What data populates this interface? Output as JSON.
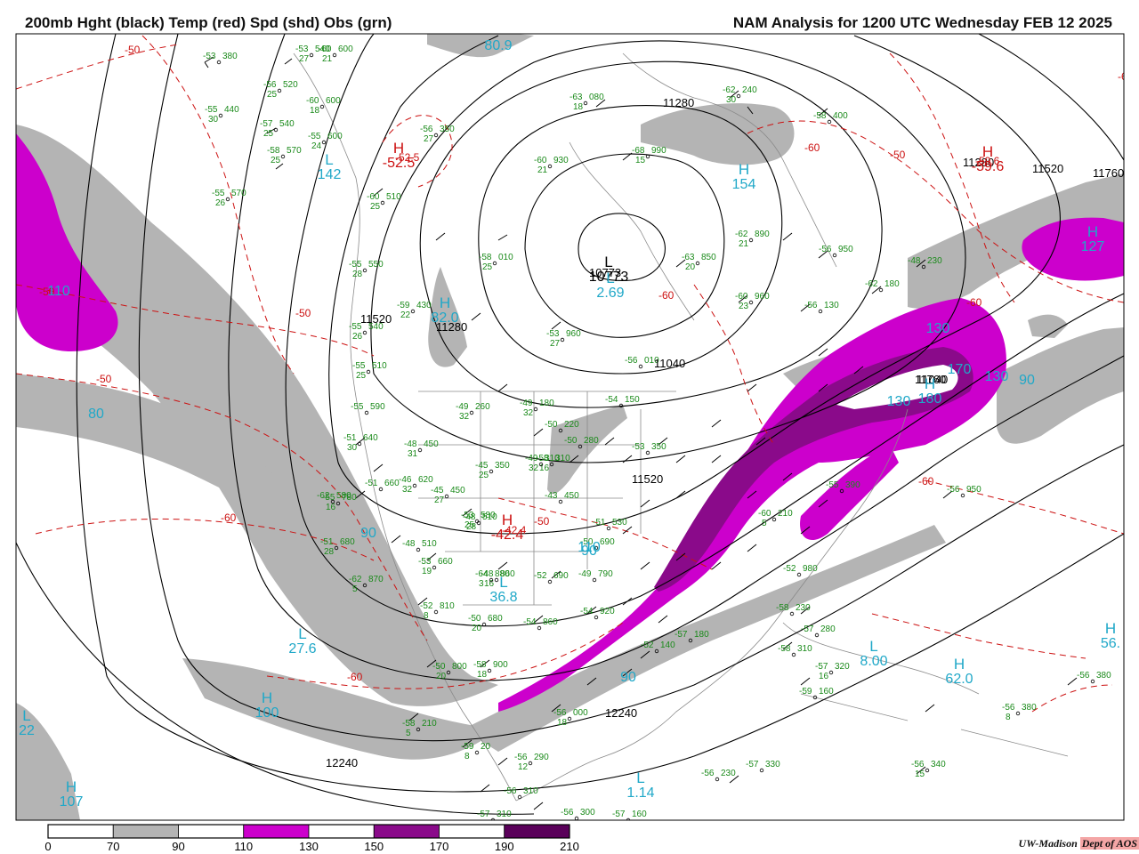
{
  "header": {
    "left_title": "200mb Hght (black) Temp (red) Spd (shd) Obs (grn)",
    "right_title": "NAM Analysis for 1200 UTC Wednesday  FEB 12 2025"
  },
  "colors": {
    "height_contour": "#000000",
    "temperature_contour": "#cc1111",
    "observations": "#1a8a1a",
    "speed_labels": "#20a8c8",
    "speed_70_90": "#b4b4b4",
    "speed_110_130": "#cc00cc",
    "speed_150_170": "#8a0a8a",
    "speed_190_210": "#5a005a"
  },
  "legend": {
    "ticks": [
      "0",
      "70",
      "90",
      "110",
      "130",
      "150",
      "170",
      "190",
      "210"
    ],
    "bins": [
      {
        "range": "0-70",
        "color": "#ffffff"
      },
      {
        "range": "70-90",
        "color": "#b4b4b4"
      },
      {
        "range": "90-110",
        "color": "#ffffff"
      },
      {
        "range": "110-130",
        "color": "#cc00cc"
      },
      {
        "range": "130-150",
        "color": "#ffffff"
      },
      {
        "range": "150-170",
        "color": "#8a0a8a"
      },
      {
        "range": "170-190",
        "color": "#ffffff"
      },
      {
        "range": "190-210",
        "color": "#5a005a"
      }
    ]
  },
  "height_labels": [
    "11520",
    "11280",
    "11040",
    "10773",
    "11280",
    "11520",
    "11760",
    "11040",
    "11520",
    "11760",
    "12240",
    "12240",
    "11280"
  ],
  "temperature_labels": [
    "-50",
    "-50",
    "-50",
    "-50",
    "-50",
    "-50",
    "-60",
    "-60",
    "-60",
    "-60",
    "-60",
    "-60",
    "-60",
    "-52.5",
    "-59.6",
    "-42.4"
  ],
  "pressure_centers": [
    {
      "type": "H",
      "value": "-52.5",
      "kind": "temp"
    },
    {
      "type": "H",
      "value": "-59.6",
      "kind": "temp"
    },
    {
      "type": "H",
      "value": "-42.4",
      "kind": "temp"
    },
    {
      "type": "L",
      "value": "10773",
      "kind": "height"
    },
    {
      "type": "L",
      "value": "142",
      "kind": "speed"
    },
    {
      "type": "H",
      "value": "154",
      "kind": "speed"
    },
    {
      "type": "H",
      "value": "127",
      "kind": "speed"
    },
    {
      "type": "H",
      "value": "82.0",
      "kind": "speed"
    },
    {
      "type": "L",
      "value": "2.69",
      "kind": "speed"
    },
    {
      "type": "L",
      "value": "27.6",
      "kind": "speed"
    },
    {
      "type": "H",
      "value": "100",
      "kind": "speed"
    },
    {
      "type": "L",
      "value": "22",
      "kind": "speed"
    },
    {
      "type": "H",
      "value": "107",
      "kind": "speed"
    },
    {
      "type": "L",
      "value": "36.8",
      "kind": "speed"
    },
    {
      "type": "L",
      "value": "8.00",
      "kind": "speed"
    },
    {
      "type": "H",
      "value": "62.0",
      "kind": "speed"
    },
    {
      "type": "H",
      "value": "56.",
      "kind": "speed"
    },
    {
      "type": "L",
      "value": "1.14",
      "kind": "speed"
    },
    {
      "type": "H",
      "value": "180",
      "kind": "speed"
    }
  ],
  "speed_labels": [
    "80.9",
    "130",
    "170",
    "130",
    "90",
    "80",
    "90",
    "90",
    "110",
    "130",
    "90",
    "110"
  ],
  "observations": [
    {
      "temp": "-53",
      "hgt": "380",
      "dew": ""
    },
    {
      "temp": "-53",
      "hgt": "540",
      "dew": "27"
    },
    {
      "temp": "-60",
      "hgt": "600",
      "dew": "21"
    },
    {
      "temp": "-56",
      "hgt": "520",
      "dew": "25"
    },
    {
      "temp": "-60",
      "hgt": "600",
      "dew": "18"
    },
    {
      "temp": "-55",
      "hgt": "440",
      "dew": "30"
    },
    {
      "temp": "-57",
      "hgt": "540",
      "dew": "25"
    },
    {
      "temp": "-55",
      "hgt": "600",
      "dew": "24"
    },
    {
      "temp": "-58",
      "hgt": "570",
      "dew": "25"
    },
    {
      "temp": "-55",
      "hgt": "570",
      "dew": "26"
    },
    {
      "temp": "-60",
      "hgt": "510",
      "dew": "25"
    },
    {
      "temp": "-55",
      "hgt": "550",
      "dew": "28"
    },
    {
      "temp": "-59",
      "hgt": "430",
      "dew": "22"
    },
    {
      "temp": "-55",
      "hgt": "540",
      "dew": "26"
    },
    {
      "temp": "-55",
      "hgt": "510",
      "dew": "25"
    },
    {
      "temp": "-55",
      "hgt": "590",
      "dew": ""
    },
    {
      "temp": "-51",
      "hgt": "640",
      "dew": "30"
    },
    {
      "temp": "-48",
      "hgt": "450",
      "dew": "31"
    },
    {
      "temp": "-51",
      "hgt": "660",
      "dew": ""
    },
    {
      "temp": "-46",
      "hgt": "620",
      "dew": "32"
    },
    {
      "temp": "-45",
      "hgt": "450",
      "dew": "27"
    },
    {
      "temp": "-55",
      "hgt": "780",
      "dew": "16"
    },
    {
      "temp": "-58",
      "hgt": "010",
      "dew": "25"
    },
    {
      "temp": "-58",
      "hgt": "310",
      "dew": "16"
    },
    {
      "temp": "-56",
      "hgt": "350",
      "dew": "27"
    },
    {
      "temp": "-60",
      "hgt": "930",
      "dew": "21"
    },
    {
      "temp": "-63",
      "hgt": "080",
      "dew": "18"
    },
    {
      "temp": "-62",
      "hgt": "240",
      "dew": "30"
    },
    {
      "temp": "-68",
      "hgt": "990",
      "dew": "15"
    },
    {
      "temp": "-58",
      "hgt": "400",
      "dew": ""
    },
    {
      "temp": "-62",
      "hgt": "890",
      "dew": "21"
    },
    {
      "temp": "-56",
      "hgt": "950",
      "dew": ""
    },
    {
      "temp": "-63",
      "hgt": "850",
      "dew": "20"
    },
    {
      "temp": "-48",
      "hgt": "230",
      "dew": ""
    },
    {
      "temp": "-62",
      "hgt": "180",
      "dew": ""
    },
    {
      "temp": "-60",
      "hgt": "960",
      "dew": "23"
    },
    {
      "temp": "-56",
      "hgt": "130",
      "dew": ""
    },
    {
      "temp": "-53",
      "hgt": "960",
      "dew": "27"
    },
    {
      "temp": "-56",
      "hgt": "010",
      "dew": ""
    },
    {
      "temp": "-49",
      "hgt": "260",
      "dew": "32"
    },
    {
      "temp": "-49",
      "hgt": "180",
      "dew": "32"
    },
    {
      "temp": "-54",
      "hgt": "150",
      "dew": ""
    },
    {
      "temp": "-50",
      "hgt": "220",
      "dew": ""
    },
    {
      "temp": "-50",
      "hgt": "280",
      "dew": ""
    },
    {
      "temp": "-53",
      "hgt": "350",
      "dew": ""
    },
    {
      "temp": "-45",
      "hgt": "350",
      "dew": "25"
    },
    {
      "temp": "-49",
      "hgt": "310",
      "dew": "32"
    },
    {
      "temp": "-48",
      "hgt": "510",
      "dew": "28"
    },
    {
      "temp": "-43",
      "hgt": "450",
      "dew": ""
    },
    {
      "temp": "-51",
      "hgt": "530",
      "dew": ""
    },
    {
      "temp": "-50",
      "hgt": "690",
      "dew": ""
    },
    {
      "temp": "-52",
      "hgt": "690",
      "dew": ""
    },
    {
      "temp": "-48",
      "hgt": "860",
      "dew": "16"
    },
    {
      "temp": "-49",
      "hgt": "790",
      "dew": ""
    },
    {
      "temp": "-54",
      "hgt": "860",
      "dew": ""
    },
    {
      "temp": "-54",
      "hgt": "920",
      "dew": ""
    },
    {
      "temp": "-52",
      "hgt": "140",
      "dew": ""
    },
    {
      "temp": "-57",
      "hgt": "180",
      "dew": ""
    },
    {
      "temp": "-58",
      "hgt": "230",
      "dew": ""
    },
    {
      "temp": "-57",
      "hgt": "280",
      "dew": ""
    },
    {
      "temp": "-58",
      "hgt": "310",
      "dew": ""
    },
    {
      "temp": "-57",
      "hgt": "320",
      "dew": "16"
    },
    {
      "temp": "-59",
      "hgt": "160",
      "dew": ""
    },
    {
      "temp": "-52",
      "hgt": "980",
      "dew": ""
    },
    {
      "temp": "-60",
      "hgt": "210",
      "dew": "5"
    },
    {
      "temp": "-56",
      "hgt": "950",
      "dew": ""
    },
    {
      "temp": "-55",
      "hgt": "390",
      "dew": ""
    },
    {
      "temp": "-56",
      "hgt": "380",
      "dew": ""
    },
    {
      "temp": "-56",
      "hgt": "380",
      "dew": "8"
    },
    {
      "temp": "-56",
      "hgt": "340",
      "dew": "15"
    },
    {
      "temp": "-57",
      "hgt": "330",
      "dew": ""
    },
    {
      "temp": "-56",
      "hgt": "230",
      "dew": ""
    },
    {
      "temp": "-56",
      "hgt": "290",
      "dew": "12"
    },
    {
      "temp": "-56",
      "hgt": "310",
      "dew": ""
    },
    {
      "temp": "-57",
      "hgt": "310",
      "dew": ""
    },
    {
      "temp": "-56",
      "hgt": "300",
      "dew": ""
    },
    {
      "temp": "-57",
      "hgt": "160",
      "dew": "11"
    },
    {
      "temp": "-58",
      "hgt": "210",
      "dew": "5"
    },
    {
      "temp": "-59",
      "hgt": "20",
      "dew": "8"
    },
    {
      "temp": "-56",
      "hgt": "000",
      "dew": "18"
    },
    {
      "temp": "-58",
      "hgt": "900",
      "dew": "18"
    },
    {
      "temp": "-50",
      "hgt": "800",
      "dew": "20"
    },
    {
      "temp": "-52",
      "hgt": "810",
      "dew": "8"
    },
    {
      "temp": "-50",
      "hgt": "680",
      "dew": "20"
    },
    {
      "temp": "-53",
      "hgt": "660",
      "dew": "19"
    },
    {
      "temp": "-64",
      "hgt": "880",
      "dew": "3"
    },
    {
      "temp": "-62",
      "hgt": "870",
      "dew": "5"
    },
    {
      "temp": "-51",
      "hgt": "680",
      "dew": "28"
    },
    {
      "temp": "-48",
      "hgt": "510",
      "dew": ""
    },
    {
      "temp": "-53",
      "hgt": "580",
      "dew": "25"
    },
    {
      "temp": "-62",
      "hgt": "580",
      "dew": ""
    }
  ],
  "credit": {
    "org": "UW-Madison",
    "dept": "Dept of AOS"
  }
}
